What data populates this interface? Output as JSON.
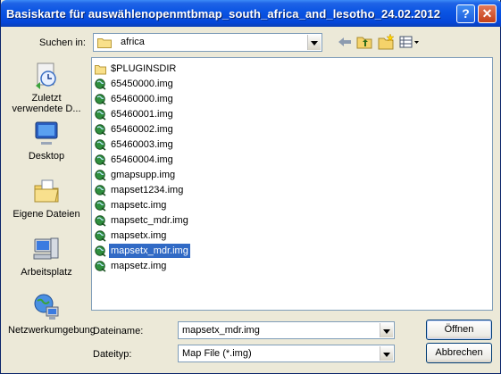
{
  "window": {
    "title": "Basiskarte für  auswählenopenmtbmap_south_africa_and_lesotho_24.02.2012",
    "help_glyph": "?",
    "close_glyph": "✕"
  },
  "lookin": {
    "label": "Suchen in:",
    "value": "africa"
  },
  "places": [
    {
      "label": "Zuletzt verwendete D...",
      "icon": "recent-docs-icon"
    },
    {
      "label": "Desktop",
      "icon": "desktop-icon"
    },
    {
      "label": "Eigene Dateien",
      "icon": "my-documents-icon"
    },
    {
      "label": "Arbeitsplatz",
      "icon": "my-computer-icon"
    },
    {
      "label": "Netzwerkumgebung",
      "icon": "network-icon"
    }
  ],
  "files": [
    {
      "name": "$PLUGINSDIR",
      "type": "folder"
    },
    {
      "name": "65450000.img",
      "type": "img"
    },
    {
      "name": "65460000.img",
      "type": "img"
    },
    {
      "name": "65460001.img",
      "type": "img"
    },
    {
      "name": "65460002.img",
      "type": "img"
    },
    {
      "name": "65460003.img",
      "type": "img"
    },
    {
      "name": "65460004.img",
      "type": "img"
    },
    {
      "name": "gmapsupp.img",
      "type": "img"
    },
    {
      "name": "mapset1234.img",
      "type": "img"
    },
    {
      "name": "mapsetc.img",
      "type": "img"
    },
    {
      "name": "mapsetc_mdr.img",
      "type": "img"
    },
    {
      "name": "mapsetx.img",
      "type": "img"
    },
    {
      "name": "mapsetx_mdr.img",
      "type": "img",
      "selected": true
    },
    {
      "name": "mapsetz.img",
      "type": "img"
    }
  ],
  "filename": {
    "label": "Dateiname:",
    "value": "mapsetx_mdr.img"
  },
  "filetype": {
    "label": "Dateityp:",
    "value": "Map File (*.img)"
  },
  "buttons": {
    "open": "Öffnen",
    "cancel": "Abbrechen"
  }
}
